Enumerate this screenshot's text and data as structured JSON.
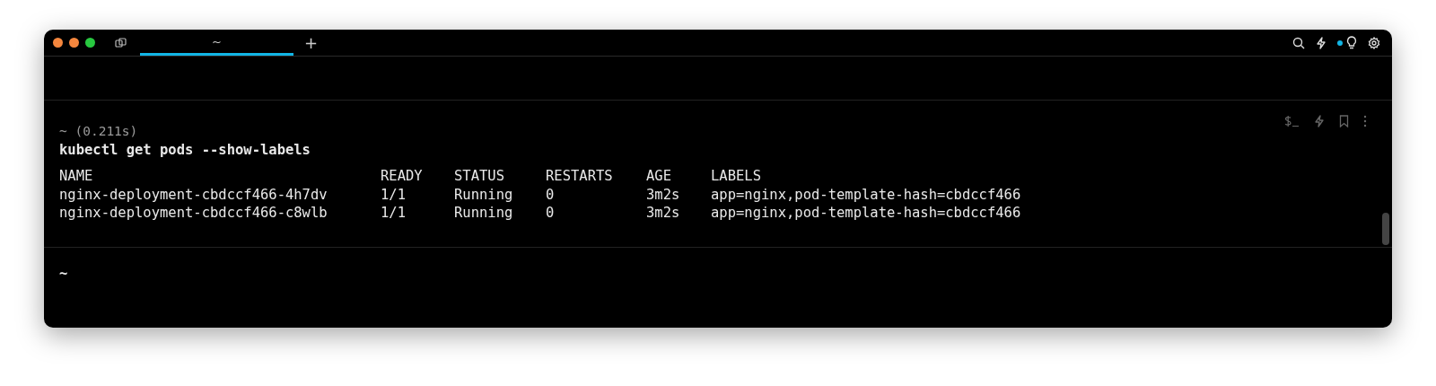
{
  "tab_bar": {
    "tabs": [
      {
        "label": "~",
        "selected": true
      }
    ],
    "new_tab": "+"
  },
  "block": {
    "prompt": "~ (0.211s)",
    "command": "kubectl get pods --show-labels",
    "table": {
      "columns": [
        "NAME",
        "READY",
        "STATUS",
        "RESTARTS",
        "AGE",
        "LABELS"
      ],
      "rows": [
        [
          "nginx-deployment-cbdccf466-4h7dv",
          "1/1",
          "Running",
          "0",
          "3m2s",
          "app=nginx,pod-template-hash=cbdccf466"
        ],
        [
          "nginx-deployment-cbdccf466-c8wlb",
          "1/1",
          "Running",
          "0",
          "3m2s",
          "app=nginx,pod-template-hash=cbdccf466"
        ]
      ]
    }
  },
  "input": {
    "prompt": "~"
  }
}
